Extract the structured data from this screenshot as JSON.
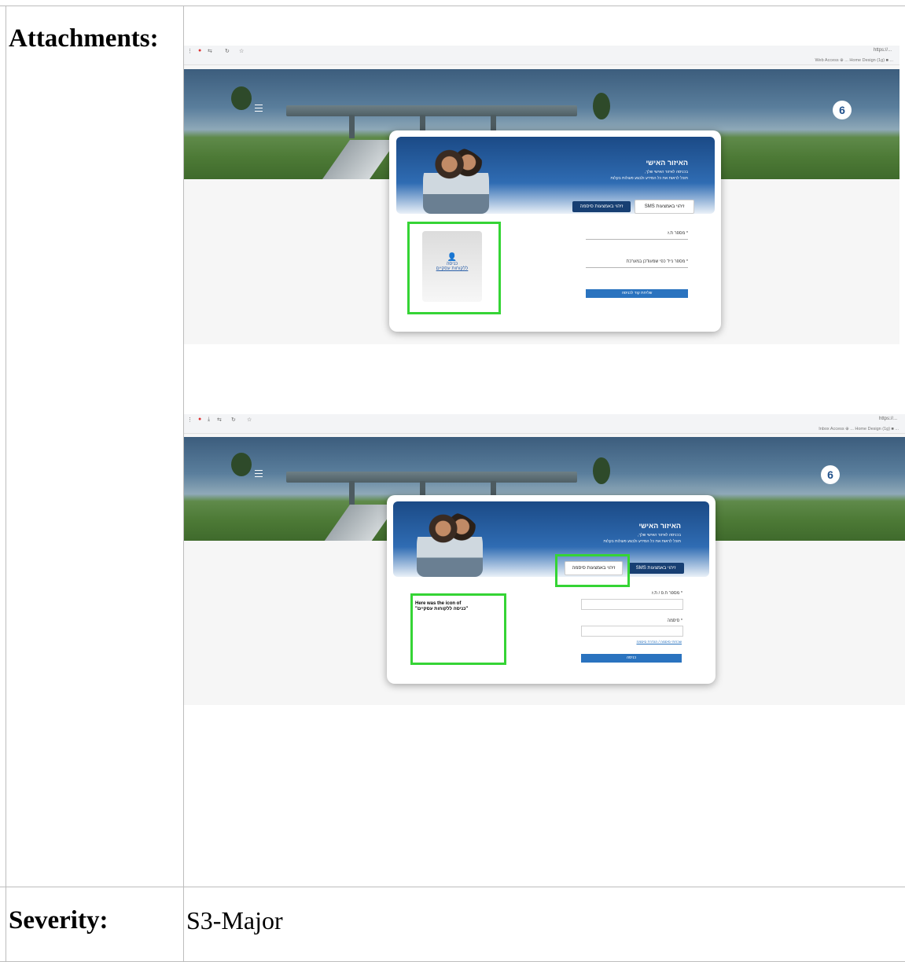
{
  "table": {
    "attachments_label": "Attachments:",
    "severity_label": "Severity:",
    "severity_value": "S3-Major"
  },
  "shot1": {
    "url": "https://...",
    "bookmarks": "Web Access ⊕ ... Home Design (1g) ■ ...",
    "banner_title": "האיזור האישי",
    "banner_line1": "בכניסה לאיזור האישי שלך,",
    "banner_line2": "תוכל לראות את כל המידע ולבצע פעולות בקלות",
    "tab_sms": "זיהוי באמצעות SMS",
    "tab_password": "זיהוי באמצעות סיסמה",
    "field1_label": "* מספר ת.ז",
    "field2_label": "* מספר נייד כפי שמעודכן במערכת",
    "submit": "שליחת קוד לכניסה",
    "tile_line1": "כניסה",
    "tile_line2": "ללקוחות עסקיים"
  },
  "shot2": {
    "url": "https://...",
    "bookmarks": "Inbox Access ⊕ ... Home Design (1g) ■ ...",
    "banner_title": "האיזור האישי",
    "banner_line1": "בכניסה לאיזור האישי שלך,",
    "banner_line2": "תוכל לראות את כל המידע ולבצע פעולות בקלות",
    "tab_sms": "זיהוי באמצעות SMS",
    "tab_password": "זיהוי באמצעות סיסמה",
    "field1_label": "* מספר ח.פ / ת.ז",
    "field2_label": "* סיסמה",
    "forgot": "שכחתי סיסמה / הגדרת סיסמה",
    "submit": "כניסה",
    "note_line1": "Here was the icon of",
    "note_line2": "\"כניסה ללקוחות עסקיים\""
  },
  "colors": {
    "highlight": "#35d435",
    "brand_blue": "#173f73",
    "button_blue": "#2a73bf"
  }
}
